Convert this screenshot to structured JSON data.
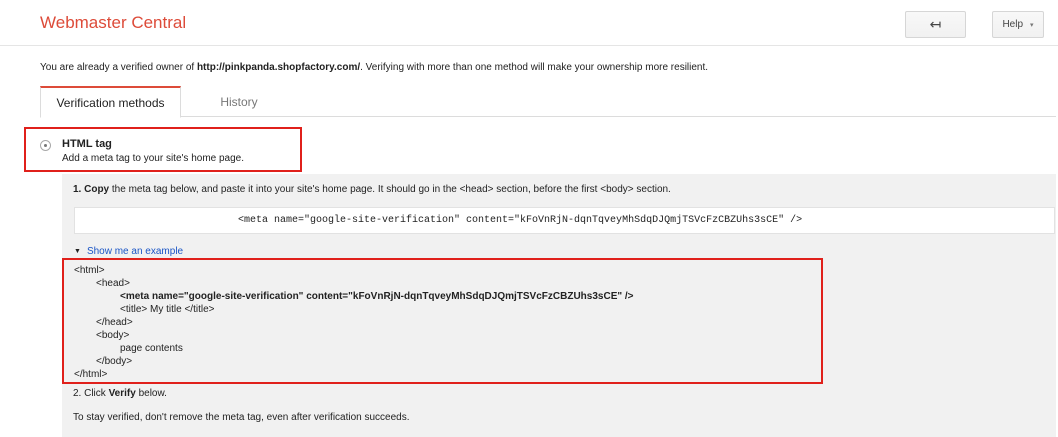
{
  "header": {
    "app_title": "Webmaster Central",
    "back_icon": "back-arrow-icon",
    "back_glyph": "↤",
    "help_label": "Help",
    "help_caret": "▾",
    "accent_color": "#dd4b39"
  },
  "owner_note": {
    "prefix": "You are already a verified owner of ",
    "site_url": "http://pinkpanda.shopfactory.com/",
    "suffix": ". Verifying with more than one method will make your ownership more resilient."
  },
  "tabs": [
    {
      "label": "Verification methods",
      "active": true
    },
    {
      "label": "History",
      "active": false
    }
  ],
  "method": {
    "title": "HTML tag",
    "description": "Add a meta tag to your site's home page.",
    "highlight_color": "#e0201b"
  },
  "step1": {
    "bold": "1. Copy",
    "text": " the meta tag below, and paste it into your site's home page. It should go in the <head> section, before the first <body> section."
  },
  "meta_tag": "<meta name=\"google-site-verification\" content=\"kFoVnRjN-dqnTqveyMhSdqDJQmjTSVcFzCBZUhs3sCE\" />",
  "example": {
    "toggle_label": "Show me an example",
    "toggle_icon": "triangle-down-icon",
    "lines": {
      "html_open": "<html>",
      "head_open": "<head>",
      "meta": "<meta name=\"google-site-verification\" content=\"kFoVnRjN-dqnTqveyMhSdqDJQmjTSVcFzCBZUhs3sCE\" />",
      "title": "<title> My title </title>",
      "head_close": "</head>",
      "body_open": "<body>",
      "body_text": "page contents",
      "body_close": "</body>",
      "html_close": "</html>"
    }
  },
  "step2": {
    "prefix": "2. Click ",
    "bold": "Verify",
    "suffix": " below."
  },
  "stay_note": "To stay verified, don't remove the meta tag, even after verification succeeds."
}
